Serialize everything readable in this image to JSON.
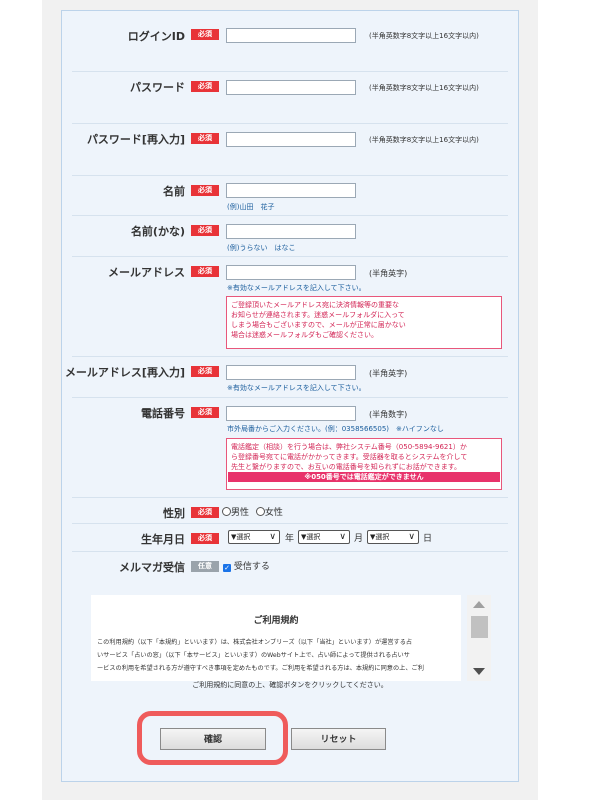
{
  "fields": {
    "login_id": {
      "label": "ログインID",
      "badge": "必須",
      "hint": "(半角英数字8文字以上16文字以内)"
    },
    "password": {
      "label": "パスワード",
      "badge": "必須",
      "hint": "(半角英数字8文字以上16文字以内)"
    },
    "password_confirm": {
      "label": "パスワード[再入力]",
      "badge": "必須",
      "hint": "(半角英数字8文字以上16文字以内)"
    },
    "name": {
      "label": "名前",
      "badge": "必須",
      "example": "(例)山田　花子"
    },
    "name_kana": {
      "label": "名前(かな)",
      "badge": "必須",
      "example": "(例)うらない　はなこ"
    },
    "email": {
      "label": "メールアドレス",
      "badge": "必須",
      "hint": "(半角英字)",
      "note_small": "※有効なメールアドレスを記入して下さい。",
      "warning": [
        "ご登録頂いたメールアドレス宛に決済情報等の重要な",
        "お知らせが連絡されます。迷惑メールフォルダに入って",
        "しまう場合もございますので、メールが正常に届かない",
        "場合は迷惑メールフォルダもご確認ください。"
      ]
    },
    "email_confirm": {
      "label": "メールアドレス[再入力]",
      "badge": "必須",
      "hint": "(半角英字)",
      "note_small": "※有効なメールアドレスを記入して下さい。"
    },
    "phone": {
      "label": "電話番号",
      "badge": "必須",
      "hint": "(半角数字)",
      "example": "市外局番からご入力ください。(例：0358566505)　※ハイフンなし",
      "warning": [
        "電話鑑定（相談）を行う場合は、弊社システム番号（050-5894-9621）か",
        "ら登録番号宛てに電話がかかってきます。受話器を取るとシステムを介して",
        "先生と繋がりますので、お互いの電話番号を知られずにお話ができます。"
      ],
      "warning_banner": "※050番号では電話鑑定ができません"
    },
    "gender": {
      "label": "性別",
      "badge": "必須",
      "options": [
        "男性",
        "女性"
      ]
    },
    "birthday": {
      "label": "生年月日",
      "badge": "必須",
      "select_text": "▼選択",
      "year": "年",
      "month": "月",
      "day": "日"
    },
    "newsletter": {
      "label": "メルマガ受信",
      "badge": "任意",
      "checkbox_label": "受信する"
    }
  },
  "terms": {
    "title": "ご利用規約",
    "lines": [
      "この利用規約（以下「本規約」といいます）は、株式会社オンブリーズ（以下「当社」といいます）が運営する占",
      "いサービス「占いの窓」（以下「本サービス」といいます）のWebサイト上で、占い師によって提供される占いサ",
      "ービスの利用を希望される方が遵守すべき事項を定めたものです。ご利用を希望される方は、本規約に同意の上、ご利"
    ],
    "agree_text": "ご利用規約に同意の上、確認ボタンをクリックしてください。"
  },
  "buttons": {
    "confirm": "確認",
    "reset": "リセット"
  },
  "colors": {
    "required": "#e83338",
    "optional": "#9aa3ab",
    "highlight_ring": "#ef5b5b",
    "panel_bg": "#eef4fb",
    "link_blue": "#1a5d9c",
    "warning_pink": "#e8577b"
  }
}
